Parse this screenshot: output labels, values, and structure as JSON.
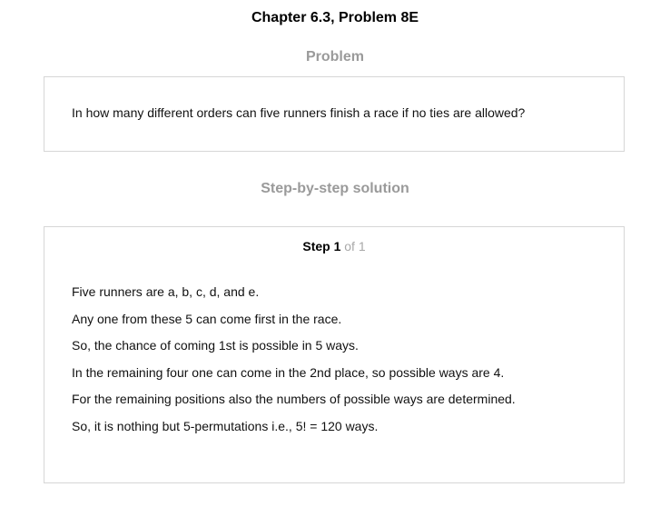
{
  "header": {
    "chapter_title": "Chapter 6.3, Problem 8E"
  },
  "problem": {
    "heading": "Problem",
    "text": "In how many different orders can five runners finish a race if no ties are allowed?"
  },
  "solution": {
    "heading": "Step-by-step solution",
    "step": {
      "label": "Step 1",
      "of": "of 1"
    },
    "lines": [
      "Five runners are a, b, c, d, and e.",
      "Any one from these 5 can come first in the race.",
      "So, the chance of coming 1st is possible in 5 ways.",
      "In the remaining four one can come in the 2nd place, so possible ways are 4.",
      "For the remaining positions also the numbers of possible ways are determined.",
      "So, it is nothing but 5-permutations i.e., 5! = 120 ways."
    ]
  }
}
